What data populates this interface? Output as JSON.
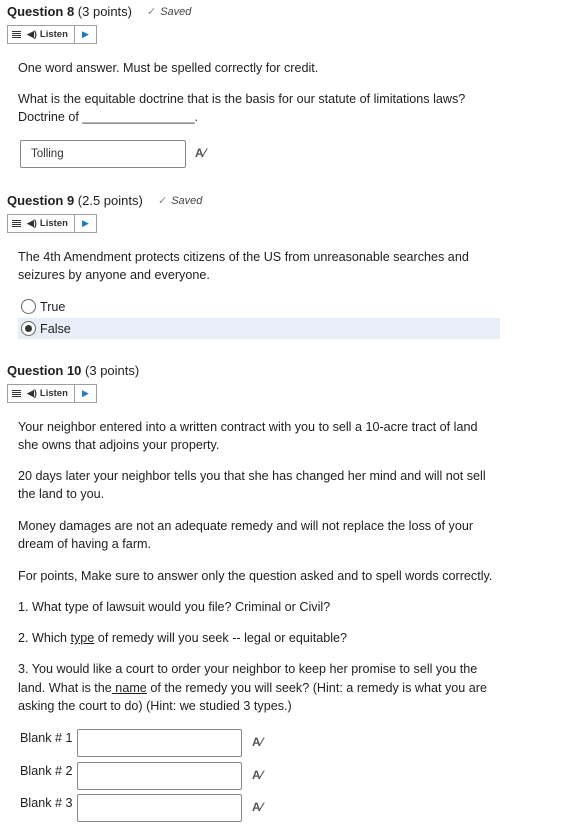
{
  "q8": {
    "title_bold": "Question 8",
    "points": " (3 points)",
    "saved": "Saved",
    "listen": "Listen",
    "p1": "One word answer. Must be spelled correctly for credit.",
    "p2a": "What is the equitable doctrine that is the basis for our statute of limitations laws?",
    "p2b": "Doctrine of ________________.",
    "answer": "Tolling"
  },
  "q9": {
    "title_bold": "Question 9",
    "points": " (2.5 points)",
    "saved": "Saved",
    "listen": "Listen",
    "p1a": "The 4th Amendment protects citizens of the US from unreasonable searches and",
    "p1b": "seizures by anyone and everyone.",
    "options": [
      "True",
      "False"
    ],
    "selected": "False"
  },
  "q10": {
    "title_bold": "Question 10",
    "points": " (3 points)",
    "listen": "Listen",
    "p1a": "Your neighbor entered into a written contract with you to sell a 10-acre tract of land",
    "p1b": "she owns that adjoins your property.",
    "p2a": "20 days later your neighbor tells you that she has changed her mind and will not sell",
    "p2b": "the land to you.",
    "p3a": "Money damages are not an adequate remedy and will not replace the loss of your",
    "p3b": "dream of having a farm.",
    "p4": "For points, Make sure to answer only the question asked and to spell words correctly.",
    "p5": "1. What type of lawsuit would you file? Criminal or Civil?",
    "p6_pre": "2. Which ",
    "p6_u": "type",
    "p6_post": " of remedy will you seek -- legal or equitable?",
    "p7a": "3. You would like a court to order your neighbor to keep her promise to sell you the",
    "p7b_pre": "land. What is the",
    "p7b_u": " name",
    "p7b_post": " of the remedy you will seek? (Hint: a remedy is what you are",
    "p7c": "asking the court to do) (Hint: we studied 3 types.)",
    "blanks": [
      "Blank # 1",
      "Blank # 2",
      "Blank # 3"
    ]
  },
  "icons": {
    "spellcheck": "spellcheck-icon",
    "speaker": "speaker-icon",
    "play": "play-icon",
    "menu": "menu-icon",
    "check": "check-icon"
  }
}
